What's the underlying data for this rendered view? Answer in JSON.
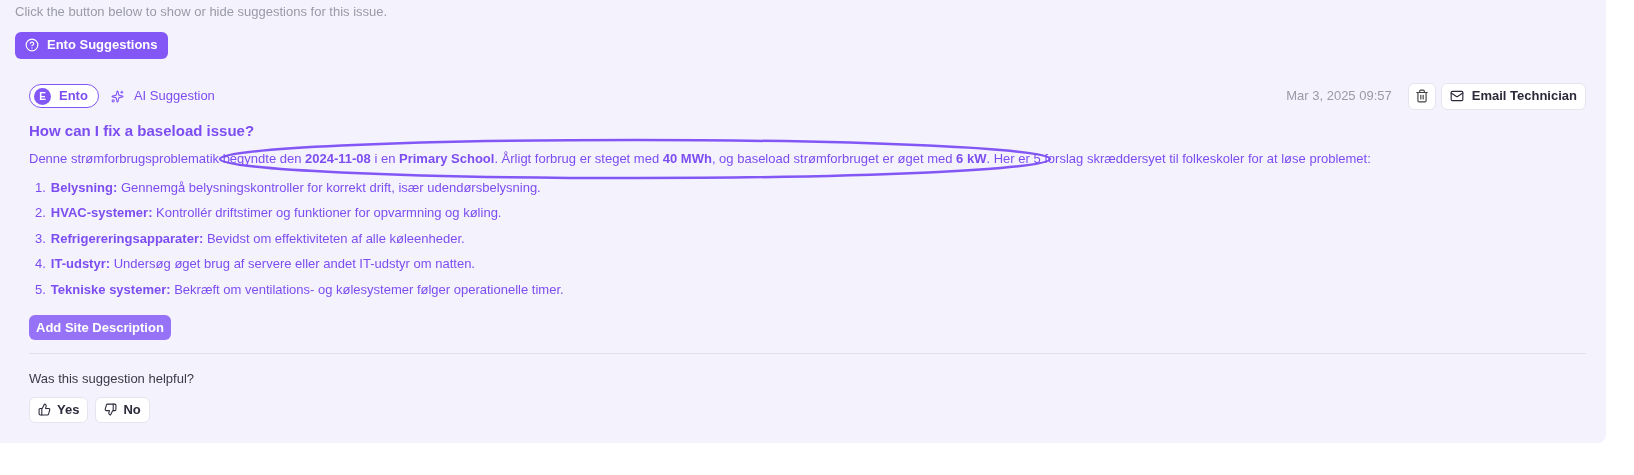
{
  "hint": "Click the button below to show or hide suggestions for this issue.",
  "toggle_button": {
    "label": "Ento Suggestions"
  },
  "suggestion": {
    "author_initial": "E",
    "author": "Ento",
    "tag": "AI Suggestion",
    "timestamp": "Mar 3, 2025 09:57",
    "email_button": "Email Technician",
    "question": "How can I fix a baseload issue?",
    "intro": "Denne strømforbrugsproblematik begyndte den **2024-11-08** i en **Primary School**. Årligt forbrug er steget med **40 MWh**, og baseload strømforbruget er øget med **6 kW**. Her er 5 forslag skræddersyet til folkeskoler for at løse problemet:",
    "items": [
      {
        "number": "1.",
        "text": "**Belysning:** Gennemgå belysningskontroller for korrekt drift, især udendørsbelysning."
      },
      {
        "number": "2.",
        "text": "**HVAC-systemer:** Kontrollér driftstimer og funktioner for opvarmning og køling."
      },
      {
        "number": "3.",
        "text": "**Refrigereringsapparater:** Bevidst om effektiviteten af alle køleenheder."
      },
      {
        "number": "4.",
        "text": "**IT-udstyr:** Undersøg øget brug af servere eller andet IT-udstyr om natten."
      },
      {
        "number": "5.",
        "text": "**Tekniske systemer:** Bekræft om ventilations- og kølesystemer følger operationelle timer."
      }
    ],
    "add_button": "Add Site Description",
    "feedback": {
      "question": "Was this suggestion helpful?",
      "yes": "Yes",
      "no": "No"
    }
  }
}
